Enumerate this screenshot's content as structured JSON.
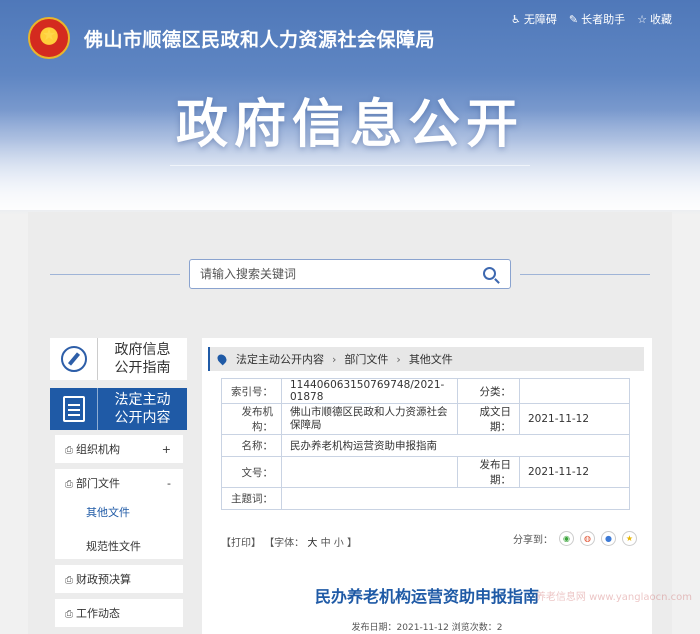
{
  "header": {
    "department": "佛山市顺德区民政和人力资源社会保障局",
    "title": "政府信息公开",
    "links": [
      {
        "icon": "accessibility-icon",
        "label": "无障碍"
      },
      {
        "icon": "elder-assist-icon",
        "label": "长者助手"
      },
      {
        "icon": "star-icon",
        "label": "收藏"
      }
    ]
  },
  "search": {
    "placeholder": "请输入搜索关键词"
  },
  "sidebar": {
    "head1": "政府信息公开指南",
    "head2": "法定主动公开内容",
    "items": [
      {
        "label": "组织机构",
        "toggle": "+"
      },
      {
        "label": "部门文件",
        "toggle": "-"
      },
      {
        "label": "财政预决算",
        "toggle": ""
      },
      {
        "label": "工作动态",
        "toggle": ""
      }
    ],
    "subitems": [
      "其他文件",
      "规范性文件"
    ]
  },
  "breadcrumb": [
    "法定主动公开内容",
    "部门文件",
    "其他文件"
  ],
  "meta": {
    "index_label": "索引号：",
    "index_value": "11440606315076974​8/2021-01878",
    "category_label": "分类：",
    "category_value": "",
    "publisher_label": "发布机构：",
    "publisher_value": "佛山市顺德区民政和人力资源社会保障局",
    "created_label": "成文日期：",
    "created_value": "2021-11-12",
    "name_label": "名称：",
    "name_value": "民办养老机构运营资助申报指南",
    "docno_label": "文号：",
    "docno_value": "",
    "pubdate_label": "发布日期：",
    "pubdate_value": "2021-11-12",
    "subject_label": "主题词：",
    "subject_value": ""
  },
  "tools": {
    "print": "【打印】",
    "font_label": "【字体：",
    "large": "大",
    "medium": "中",
    "small": "小",
    "close": "】"
  },
  "share": {
    "label": "分享到："
  },
  "document": {
    "title": "民办养老机构运营资助申报指南",
    "meta_line": "发布日期：2021-11-12  浏览次数：2"
  },
  "watermark": "养老信息网 www.yanglaocn.com",
  "colors": {
    "brand": "#1f5aa6",
    "banner": "#5f86c3"
  }
}
